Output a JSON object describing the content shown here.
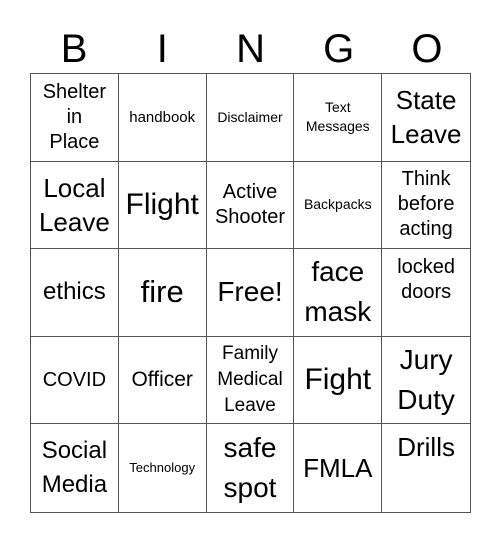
{
  "header": [
    "B",
    "I",
    "N",
    "G",
    "O"
  ],
  "cells": [
    "Shelter\nin\nPlace",
    "handbook",
    "Disclaimer",
    "Text\nMessages",
    "State\nLeave",
    "Local\nLeave",
    "Flight",
    "Active\nShooter",
    "Backpacks",
    "Think\nbefore\nacting",
    "ethics",
    "fire",
    "Free!",
    "face\nmask",
    "locked\ndoors",
    "COVID",
    "Officer",
    "Family\nMedical\nLeave",
    "Fight",
    "Jury\nDuty",
    "Social\nMedia",
    "Technology",
    "safe\nspot",
    "FMLA",
    "Drills"
  ]
}
